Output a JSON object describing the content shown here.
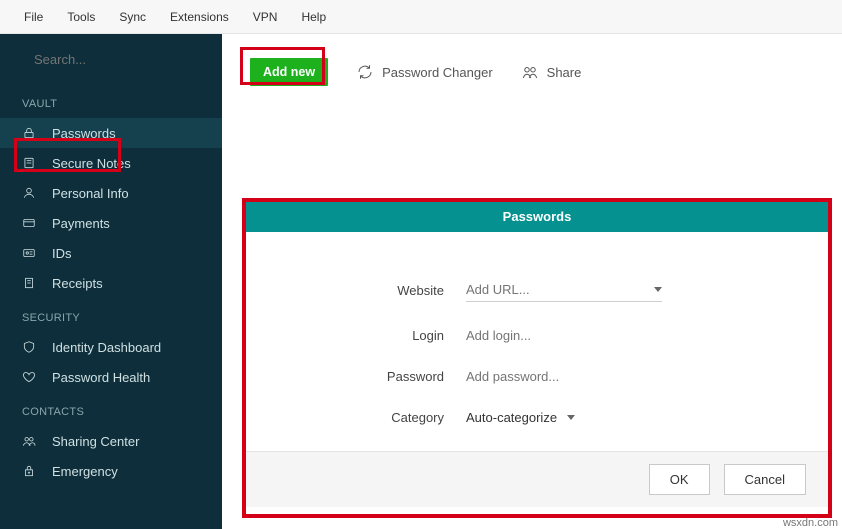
{
  "menubar": [
    "File",
    "Tools",
    "Sync",
    "Extensions",
    "VPN",
    "Help"
  ],
  "search": {
    "placeholder": "Search..."
  },
  "sidebar": {
    "sections": [
      {
        "title": "VAULT",
        "items": [
          {
            "label": "Passwords",
            "active": true
          },
          {
            "label": "Secure Notes"
          },
          {
            "label": "Personal Info"
          },
          {
            "label": "Payments"
          },
          {
            "label": "IDs"
          },
          {
            "label": "Receipts"
          }
        ]
      },
      {
        "title": "SECURITY",
        "items": [
          {
            "label": "Identity Dashboard"
          },
          {
            "label": "Password Health"
          }
        ]
      },
      {
        "title": "CONTACTS",
        "items": [
          {
            "label": "Sharing Center"
          },
          {
            "label": "Emergency"
          }
        ]
      }
    ]
  },
  "toolbar": {
    "addnew": "Add new",
    "pwchanger": "Password Changer",
    "share": "Share"
  },
  "panel": {
    "title": "Passwords",
    "rows": {
      "website": {
        "label": "Website",
        "placeholder": "Add URL..."
      },
      "login": {
        "label": "Login",
        "placeholder": "Add login..."
      },
      "password": {
        "label": "Password",
        "placeholder": "Add password..."
      },
      "category": {
        "label": "Category",
        "value": "Auto-categorize"
      }
    },
    "ok": "OK",
    "cancel": "Cancel"
  },
  "watermark": "wsxdn.com"
}
